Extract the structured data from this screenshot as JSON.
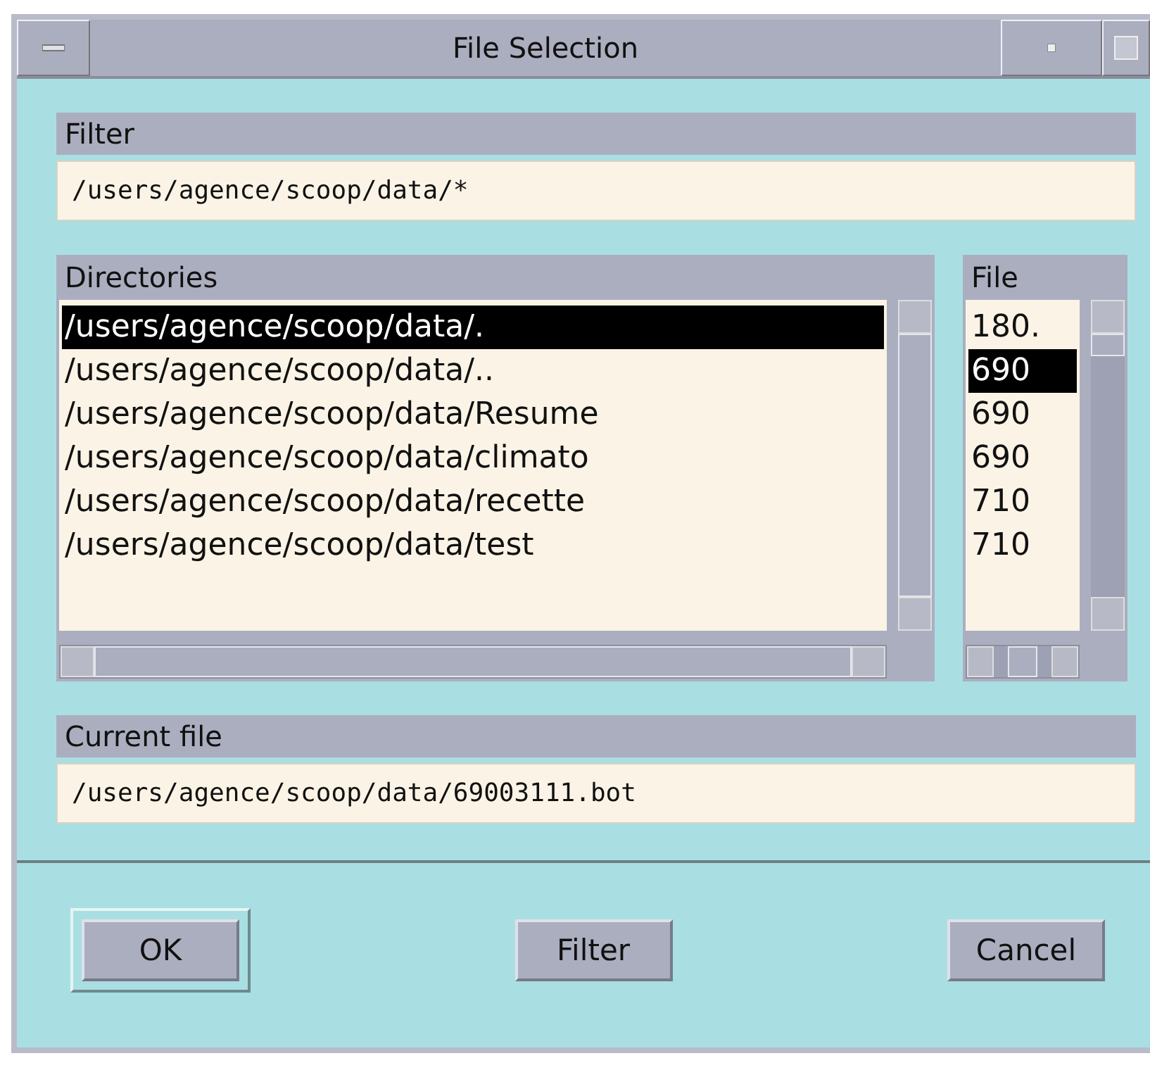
{
  "window": {
    "title": "File Selection"
  },
  "filter": {
    "label": "Filter",
    "value": "/users/agence/scoop/data/*"
  },
  "directories": {
    "label": "Directories",
    "items": [
      {
        "name": "/users/agence/scoop/data/.",
        "selected": true
      },
      {
        "name": "/users/agence/scoop/data/..",
        "selected": false
      },
      {
        "name": "/users/agence/scoop/data/Resume",
        "selected": false
      },
      {
        "name": "/users/agence/scoop/data/climato",
        "selected": false
      },
      {
        "name": "/users/agence/scoop/data/recette",
        "selected": false
      },
      {
        "name": "/users/agence/scoop/data/test",
        "selected": false
      }
    ]
  },
  "files": {
    "label": "File",
    "items": [
      {
        "name": "180.",
        "selected": false
      },
      {
        "name": "690",
        "selected": true
      },
      {
        "name": "690",
        "selected": false
      },
      {
        "name": "690",
        "selected": false
      },
      {
        "name": "710",
        "selected": false
      },
      {
        "name": "710",
        "selected": false
      }
    ]
  },
  "current_file": {
    "label": "Current file",
    "value": "/users/agence/scoop/data/69003111.bot"
  },
  "buttons": [
    {
      "label": "OK",
      "default": true
    },
    {
      "label": "Filter",
      "default": false
    },
    {
      "label": "Cancel",
      "default": false
    }
  ]
}
